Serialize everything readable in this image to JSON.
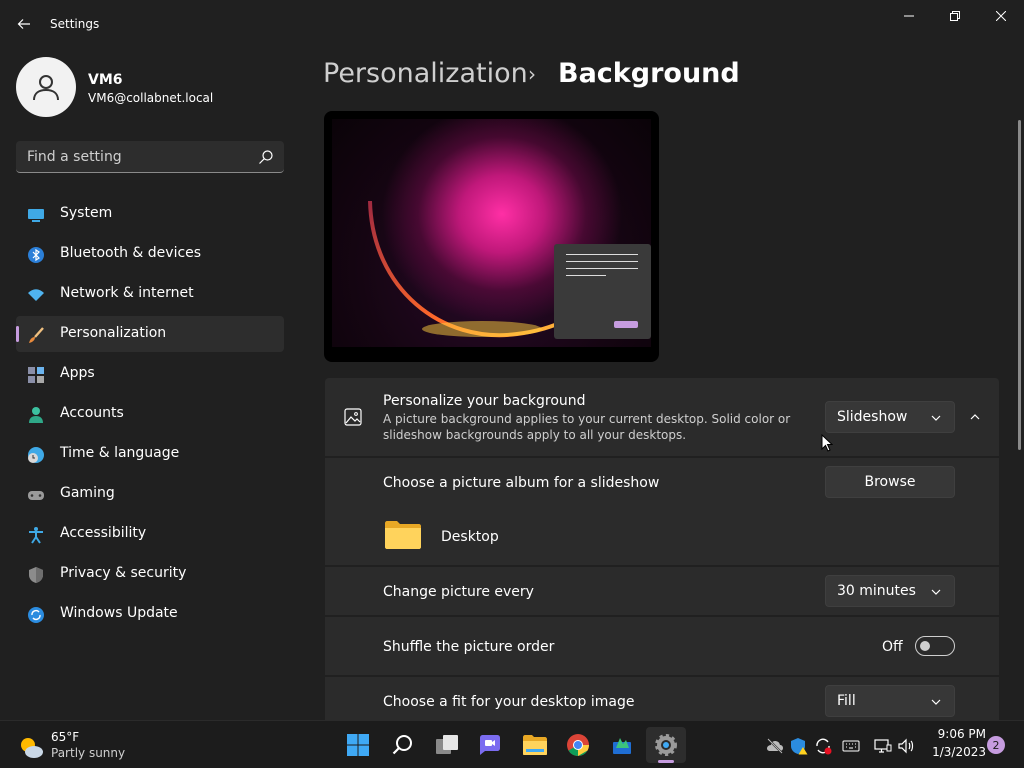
{
  "window": {
    "title": "Settings"
  },
  "profile": {
    "name": "VM6",
    "email": "VM6@collabnet.local"
  },
  "search": {
    "placeholder": "Find a setting"
  },
  "nav": {
    "items": [
      {
        "label": "System",
        "icon": "system-icon"
      },
      {
        "label": "Bluetooth & devices",
        "icon": "bluetooth-icon"
      },
      {
        "label": "Network & internet",
        "icon": "wifi-icon"
      },
      {
        "label": "Personalization",
        "icon": "brush-icon",
        "active": true
      },
      {
        "label": "Apps",
        "icon": "apps-icon"
      },
      {
        "label": "Accounts",
        "icon": "person-icon"
      },
      {
        "label": "Time & language",
        "icon": "clock-globe-icon"
      },
      {
        "label": "Gaming",
        "icon": "gamepad-icon"
      },
      {
        "label": "Accessibility",
        "icon": "accessibility-icon"
      },
      {
        "label": "Privacy & security",
        "icon": "shield-icon"
      },
      {
        "label": "Windows Update",
        "icon": "update-icon"
      }
    ]
  },
  "header": {
    "parent": "Personalization",
    "separator": "›",
    "current": "Background"
  },
  "background_card": {
    "title": "Personalize your background",
    "description_line1": "A picture background applies to your current desktop. Solid color or",
    "description_line2": "slideshow backgrounds apply to all your desktops.",
    "selected": "Slideshow"
  },
  "album": {
    "label": "Choose a picture album for a slideshow",
    "browse_label": "Browse",
    "folder_name": "Desktop"
  },
  "interval": {
    "label": "Change picture every",
    "selected": "30 minutes"
  },
  "shuffle": {
    "label": "Shuffle the picture order",
    "state_label": "Off",
    "on": false
  },
  "fit": {
    "label": "Choose a fit for your desktop image",
    "selected": "Fill"
  },
  "taskbar": {
    "weather_temp": "65°F",
    "weather_desc": "Partly sunny",
    "time": "9:06 PM",
    "date": "1/3/2023",
    "notification_count": "2"
  },
  "colors": {
    "accent": "#c69cdf",
    "background": "#202020",
    "card": "#2b2b2b"
  }
}
